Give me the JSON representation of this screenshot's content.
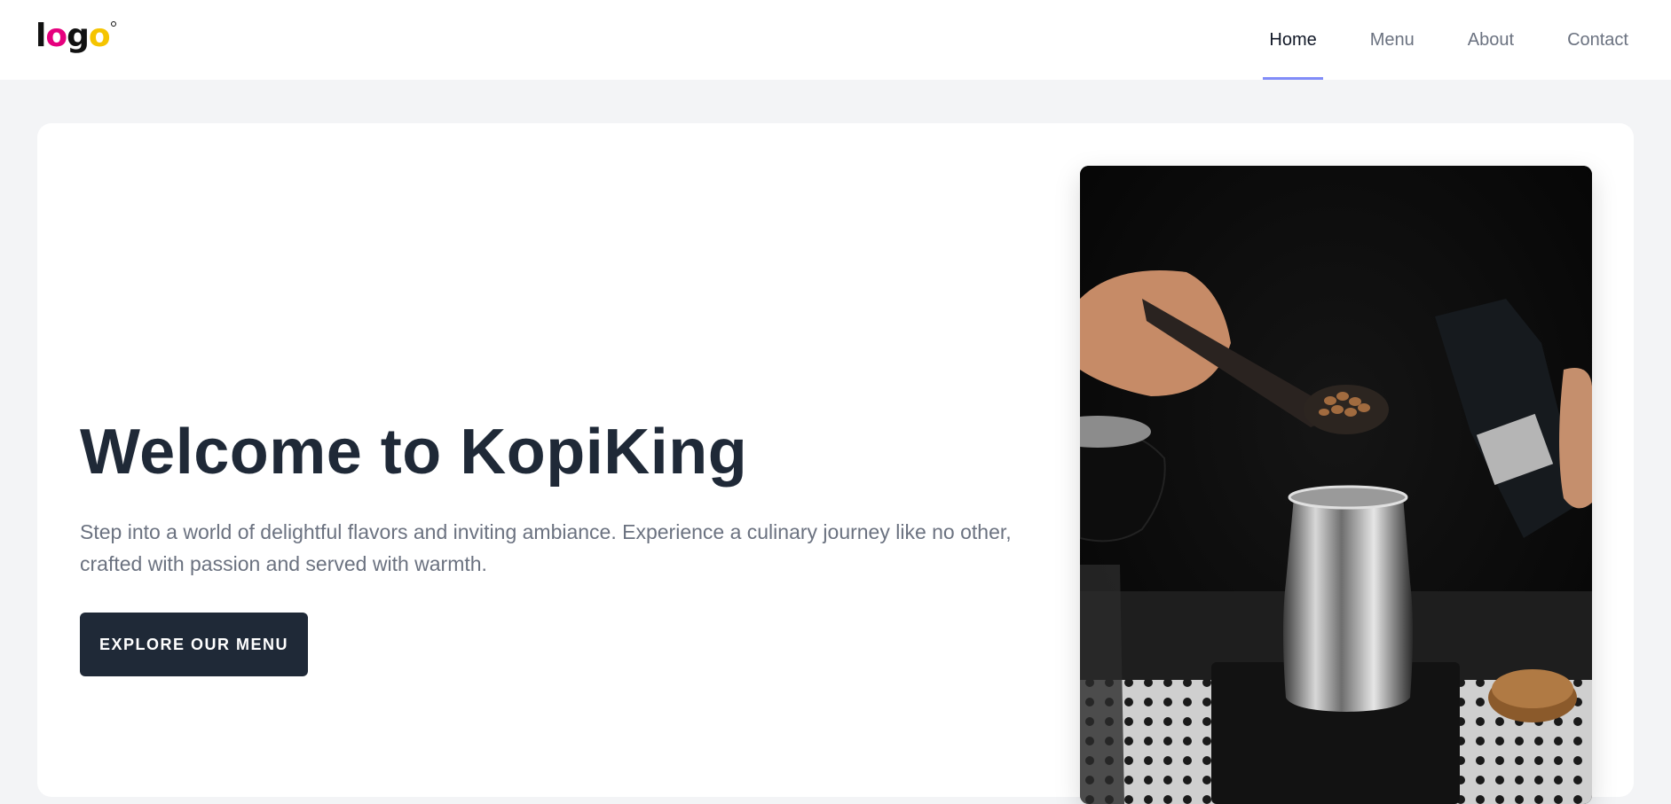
{
  "header": {
    "logo_text": "logo",
    "nav": [
      {
        "label": "Home",
        "active": true
      },
      {
        "label": "Menu",
        "active": false
      },
      {
        "label": "About",
        "active": false
      },
      {
        "label": "Contact",
        "active": false
      }
    ]
  },
  "hero": {
    "title": "Welcome to KopiKing",
    "subtitle": "Step into a world of delightful flavors and inviting ambiance. Experience a culinary journey like no other, crafted with passion and served with warmth.",
    "cta_label": "EXPLORE OUR MENU",
    "image_icon": "coffee-brewing-photo"
  },
  "colors": {
    "page_bg": "#f3f4f6",
    "card_bg": "#ffffff",
    "title": "#1f2937",
    "text_muted": "#6b7280",
    "button_bg": "#1f2937",
    "active_underline": "#818cf8",
    "logo_pink": "#e6007e",
    "logo_yellow": "#f5c400"
  }
}
